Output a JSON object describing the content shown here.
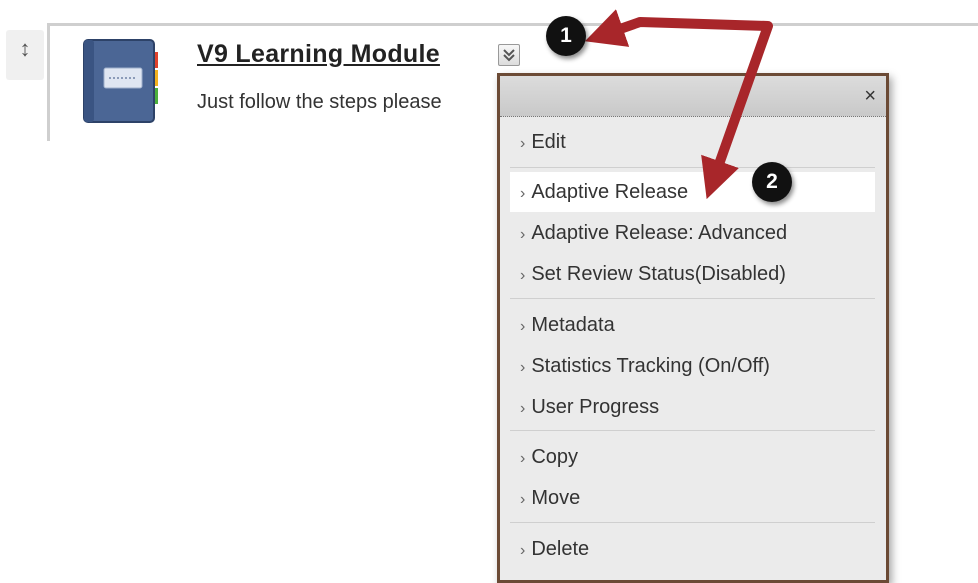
{
  "item": {
    "title": "V9 Learning Module",
    "description": "Just follow the steps please"
  },
  "drag_handle_glyph": "↕",
  "menu_toggle_glyph": "⌄",
  "callouts": [
    "1",
    "2"
  ],
  "menu": {
    "close_glyph": "×",
    "chevron": "›",
    "groups": [
      [
        "Edit"
      ],
      [
        "Adaptive Release",
        "Adaptive Release: Advanced",
        "Set Review Status(Disabled)"
      ],
      [
        "Metadata",
        "Statistics Tracking (On/Off)",
        "User Progress"
      ],
      [
        "Copy",
        "Move"
      ],
      [
        "Delete"
      ]
    ],
    "highlighted_item": "Adaptive Release"
  },
  "colors": {
    "arrow": "#a8262a",
    "menu_border": "#6b4a35",
    "highlight": "#ffffff",
    "menu_background": "#ebebeb"
  }
}
